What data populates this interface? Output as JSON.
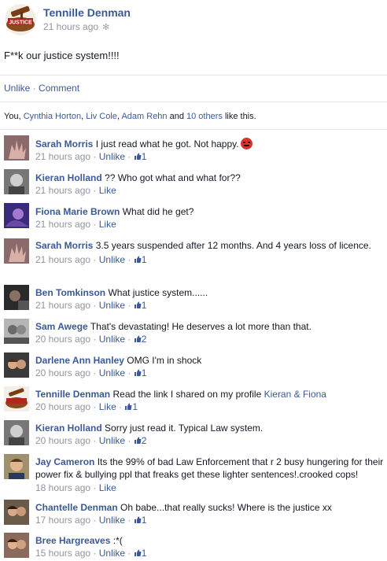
{
  "post": {
    "author": "Tennille Denman",
    "time": "21 hours ago",
    "text": "F**k our justice system!!!!",
    "actions": {
      "unlike": "Unlike",
      "sep": " · ",
      "comment": "Comment"
    },
    "likes": {
      "prefix": "You, ",
      "names": [
        "Cynthia Horton",
        "Liv Cole",
        "Adam Rehn"
      ],
      "and": " and ",
      "others": "10 others",
      "suffix": " like this."
    }
  },
  "comments": [
    {
      "name": "Sarah Morris",
      "text": "I just read what he got. Not happy.",
      "time": "21 hours ago",
      "action": "Unlike",
      "likes": "1",
      "emoji": "angry-face",
      "avatar": "hand-icon"
    },
    {
      "name": "Kieran Holland",
      "text": "?? Who got what and what for??",
      "time": "21 hours ago",
      "action": "Like",
      "likes": "",
      "avatar": "bw-face-icon"
    },
    {
      "name": "Fiona Marie Brown",
      "text": "What did he get?",
      "time": "21 hours ago",
      "action": "Like",
      "likes": "",
      "avatar": "purple-photo-icon"
    },
    {
      "name": "Sarah Morris",
      "text": "3.5 years suspended after 12 months. And 4 years loss of licence.",
      "time": "21 hours ago",
      "action": "Unlike",
      "likes": "1",
      "avatar": "hand-icon"
    },
    {
      "name": "Ben Tomkinson",
      "text": "What justice system......",
      "time": "21 hours ago",
      "action": "Unlike",
      "likes": "1",
      "avatar": "dark-photo-icon"
    },
    {
      "name": "Sam Awege",
      "text": "That's devastating! He deserves a lot more than that.",
      "time": "20 hours ago",
      "action": "Unlike",
      "likes": "2",
      "avatar": "grey-photo-icon"
    },
    {
      "name": "Darlene Ann Hanley",
      "text": "OMG I'm in shock",
      "time": "20 hours ago",
      "action": "Unlike",
      "likes": "1",
      "avatar": "couple-photo-icon"
    },
    {
      "name": "Tennille Denman",
      "text": "Read the link I shared on my profile ",
      "link": "Kieran & Fiona",
      "time": "20 hours ago",
      "action": "Like",
      "likes": "1",
      "avatar": "justice-icon"
    },
    {
      "name": "Kieran Holland",
      "text": "Sorry just read it. Typical Law system.",
      "time": "20 hours ago",
      "action": "Unlike",
      "likes": "2",
      "avatar": "bw-face-icon"
    },
    {
      "name": "Jay Cameron",
      "text": "Its the 99% of bad Law Enforcement that r 2 busy hungering for their power fix & bullying ppl that freaks get these lighter sentences!.crooked cops!",
      "time": "18 hours ago",
      "action": "Like",
      "likes": "",
      "avatar": "man-photo-icon"
    },
    {
      "name": "Chantelle Denman",
      "text": "Oh babe...that really sucks! Where is the justice xx",
      "time": "17 hours ago",
      "action": "Unlike",
      "likes": "1",
      "avatar": "couple-photo-icon"
    },
    {
      "name": "Bree Hargreaves",
      "text": ":*(",
      "time": "15 hours ago",
      "action": "Unlike",
      "likes": "1",
      "avatar": "couple-photo-icon"
    }
  ]
}
